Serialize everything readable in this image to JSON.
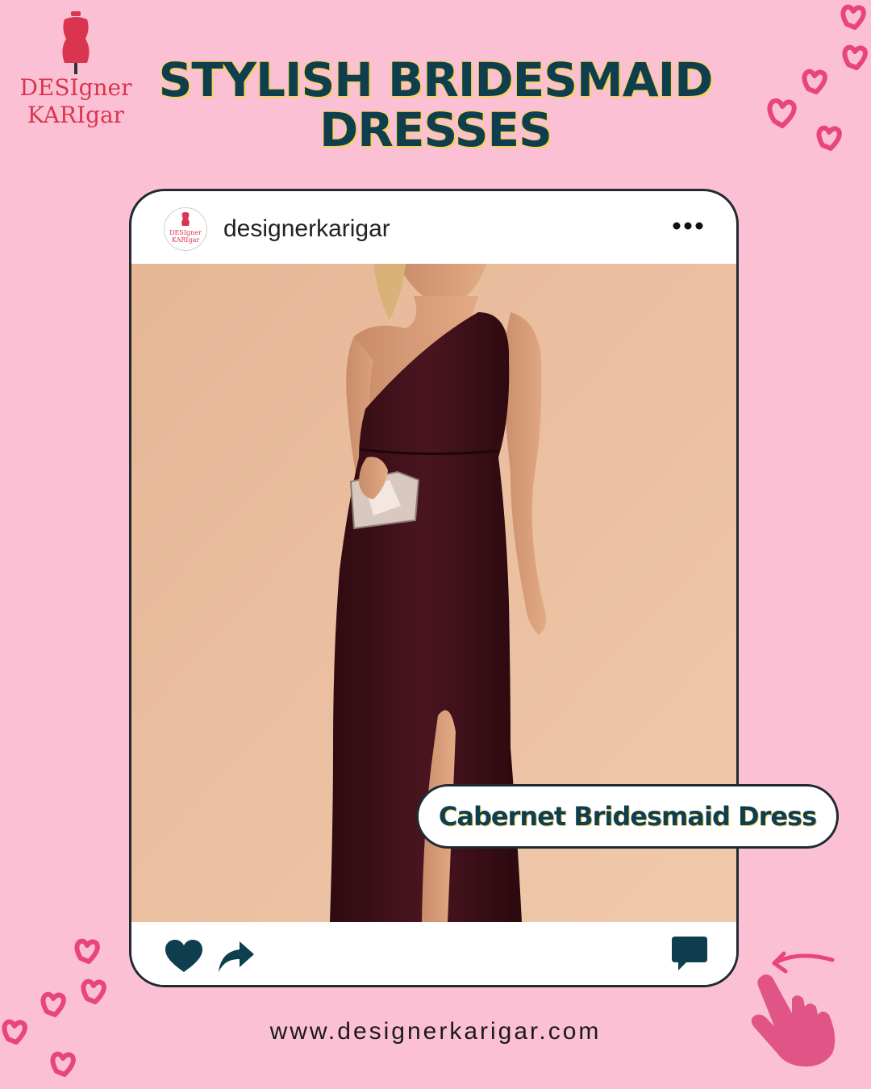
{
  "brand": {
    "logo_line1": "DESIgner",
    "logo_line2": "KARIgar",
    "logo_icon": "dress-form-icon",
    "color": "#d9354f"
  },
  "headline": {
    "line1": "STYLISH BRIDESMAID",
    "line2": "DRESSES",
    "color": "#0f3e4e",
    "outline_color": "#f4d25c"
  },
  "post": {
    "username": "designerkarigar",
    "avatar_logo_line1": "DESIgner",
    "avatar_logo_line2": "KARIgar",
    "more_icon": "more-horizontal-icon",
    "actions": {
      "like_icon": "heart-icon",
      "share_icon": "share-arrow-icon",
      "comment_icon": "comment-icon"
    },
    "photo_description_icon": "dress-photo"
  },
  "caption": "Cabernet Bridesmaid Dress",
  "website": "www.designerkarigar.com",
  "decor": {
    "hearts_icon": "heart-outline-icon",
    "hand_icon": "swipe-hand-icon",
    "accent": "#e8457a",
    "background": "#fcc0d4"
  }
}
